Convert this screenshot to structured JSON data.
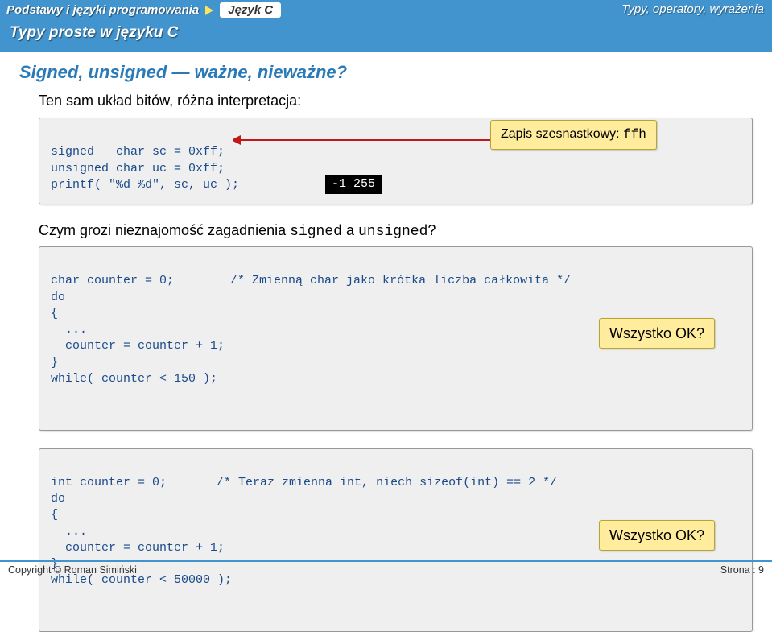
{
  "breadcrumb": {
    "item1": "Podstawy i języki programowania",
    "item2": "Język C"
  },
  "header_right": "Typy, operatory, wyrażenia",
  "subheader": "Typy proste w języku C",
  "title": "Signed, unsigned — ważne, nieważne?",
  "intro": "Ten sam układ bitów, różna interpretacja:",
  "code1": {
    "line1": "signed   char sc = 0xff;",
    "line2": "unsigned char uc = 0xff;",
    "line3": "printf( \"%d %d\", sc, uc );",
    "output": "-1 255"
  },
  "annot1_prefix": "Zapis szesnastkowy: ",
  "annot1_mono": "ffh",
  "question_prefix": "Czym grozi nieznajomość zagadnienia ",
  "question_mono1": "signed",
  "question_mid": " a ",
  "question_mono2": "unsigned",
  "question_suffix": "?",
  "code2": {
    "line1a": "char counter = 0;",
    "line1b": "/* Zmienną char jako krótka liczba całkowita */",
    "line2": "do",
    "line3": "{",
    "line4": "  ...",
    "line5": "  counter = counter + 1;",
    "line6": "}",
    "line7": "while( counter < 150 );"
  },
  "annot_ok": "Wszystko OK?",
  "code3": {
    "line1a": "int counter = 0;",
    "line1b": "/* Teraz zmienna int, niech sizeof(int) == 2 */",
    "line2": "do",
    "line3": "{",
    "line4": "  ...",
    "line5": "  counter = counter + 1;",
    "line6": "}",
    "line7": "while( counter < 50000 );"
  },
  "footer_left": "Copyright © Roman Simiński",
  "footer_right": "Strona : 9"
}
